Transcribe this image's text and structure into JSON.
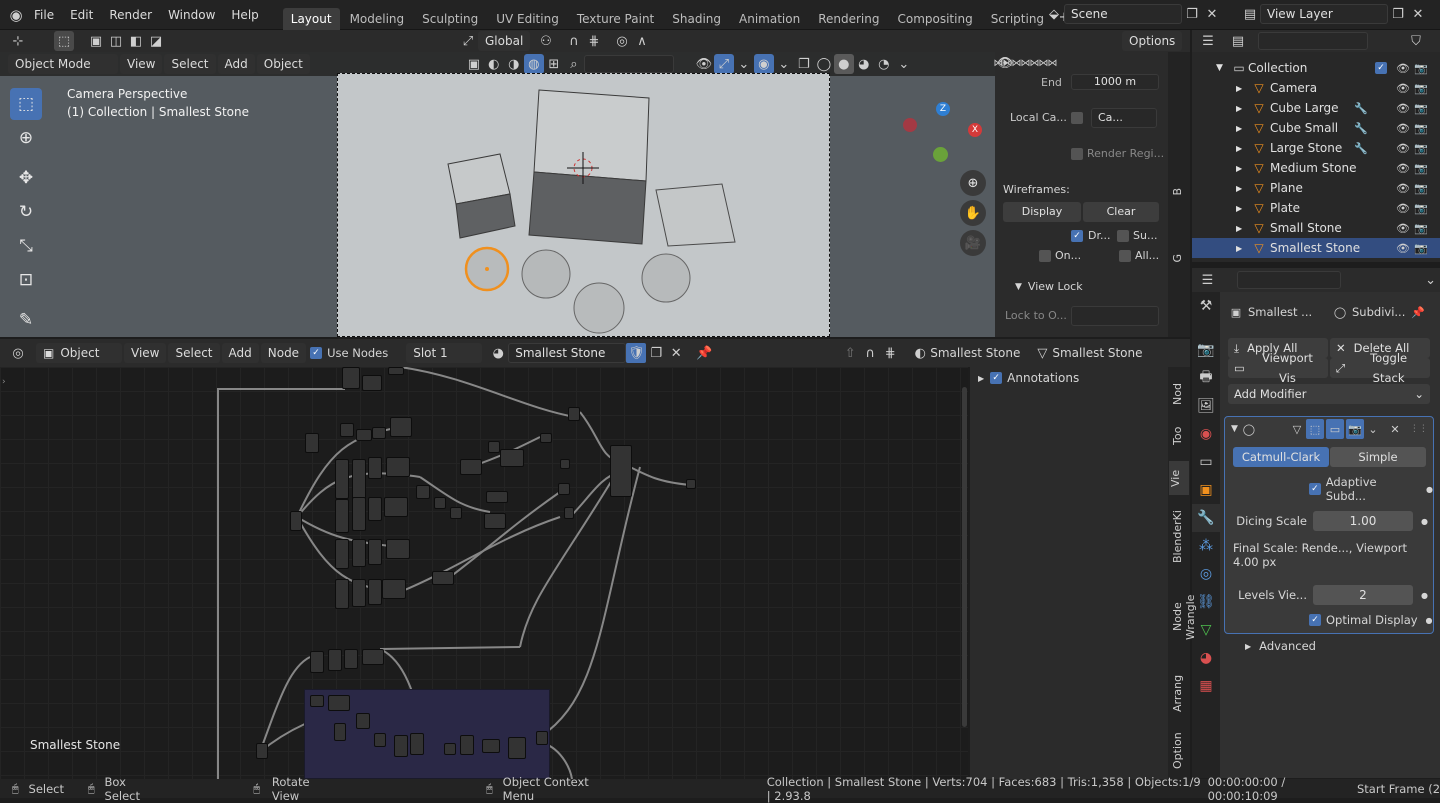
{
  "topbar": {
    "menus": [
      "File",
      "Edit",
      "Render",
      "Window",
      "Help"
    ],
    "workspaces": [
      "Layout",
      "Modeling",
      "Sculpting",
      "UV Editing",
      "Texture Paint",
      "Shading",
      "Animation",
      "Rendering",
      "Compositing",
      "Scripting"
    ],
    "active_workspace": "Layout",
    "scene": "Scene",
    "view_layer": "View Layer"
  },
  "viewport_header": {
    "transform_orientation": "Global",
    "options": "Options",
    "mode": "Object Mode",
    "menus": [
      "View",
      "Select",
      "Add",
      "Object"
    ]
  },
  "viewport": {
    "camera_label": "Camera Perspective",
    "collection_label": "(1) Collection | Smallest Stone",
    "gizmo_axes": {
      "x": "X",
      "y": "Y",
      "z": "Z"
    }
  },
  "npanel": {
    "end_label": "End",
    "end_value": "1000 m",
    "local_camera_label": "Local Ca...",
    "local_camera_value": "Ca...",
    "render_region": "Render Regi...",
    "wireframes_label": "Wireframes:",
    "display_btn": "Display",
    "clear_btn": "Clear",
    "dr": "Dr...",
    "su": "Su...",
    "on": "On...",
    "all": "All...",
    "view_lock": "View Lock",
    "lock_to": "Lock to O...",
    "tabs": [
      "B",
      "G"
    ]
  },
  "outliner": {
    "collection": "Collection",
    "items": [
      "Camera",
      "Cube Large",
      "Cube Small",
      "Large Stone",
      "Medium Stone",
      "Plane",
      "Plate",
      "Small Stone",
      "Smallest Stone"
    ],
    "selected": "Smallest Stone"
  },
  "properties": {
    "object_name": "Smallest ...",
    "modifier_name": "Subdivi...",
    "apply_all": "Apply All",
    "delete_all": "Delete All",
    "viewport_vis": "Viewport Vis",
    "toggle_stack": "Toggle Stack",
    "add_modifier": "Add Modifier",
    "catmull": "Catmull-Clark",
    "simple": "Simple",
    "adaptive": "Adaptive Subd...",
    "dicing_scale_label": "Dicing Scale",
    "dicing_scale_value": "1.00",
    "final_scale": "Final Scale: Rende..., Viewport 4.00 px",
    "levels_label": "Levels Vie...",
    "levels_value": "2",
    "optimal_display": "Optimal Display",
    "advanced": "Advanced"
  },
  "node_header": {
    "editor": "Object",
    "menus": [
      "View",
      "Select",
      "Add",
      "Node"
    ],
    "use_nodes": "Use Nodes",
    "slot": "Slot 1",
    "material": "Smallest Stone",
    "object": "Smallest Stone",
    "mesh": "Smallest Stone"
  },
  "node_sidebar": {
    "annotations": "Annotations",
    "tabs": [
      "Nod",
      "Too",
      "Vie",
      "BlenderKi",
      "Node Wrangle",
      "Arrang",
      "Option"
    ]
  },
  "node_editor": {
    "label": "Smallest Stone"
  },
  "statusbar": {
    "select": "Select",
    "box_select": "Box Select",
    "rotate_view": "Rotate View",
    "context_menu": "Object Context Menu",
    "stats": "Collection | Smallest Stone | Verts:704 | Faces:683 | Tris:1,358 | Objects:1/9 | 2.93.8",
    "time": "00:00:00:00 / 00:00:10:09",
    "start_frame": "Start Frame (2"
  },
  "colors": {
    "accent": "#4772b3",
    "selected_row": "#334d80",
    "orange_select": "#f0901e",
    "header": "#2b2b2b"
  }
}
